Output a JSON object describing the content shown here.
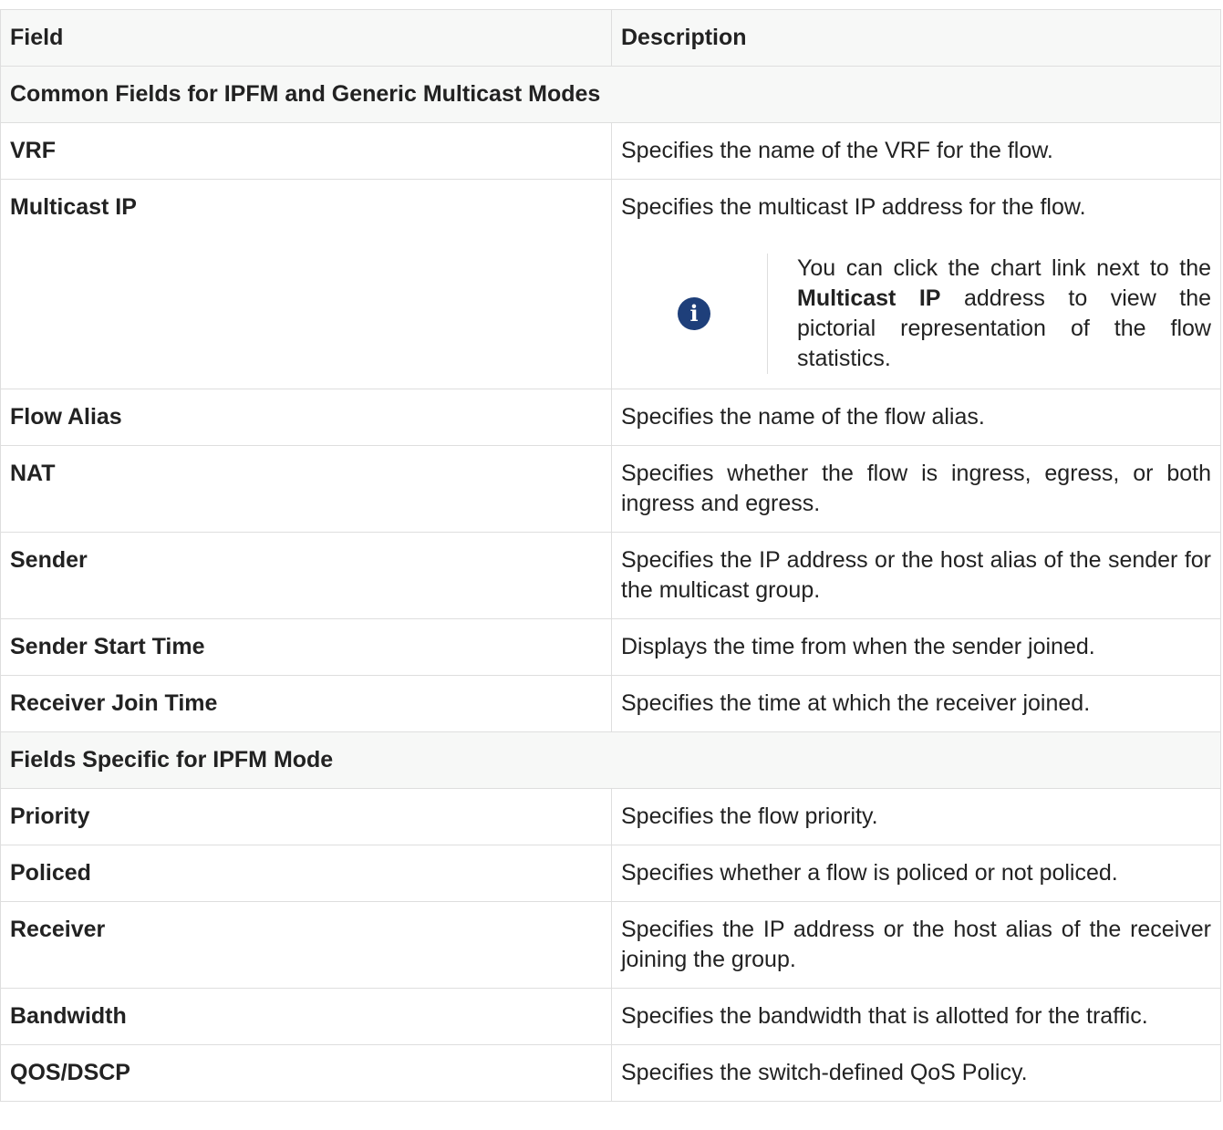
{
  "table": {
    "headers": {
      "field": "Field",
      "description": "Description"
    },
    "sections": [
      {
        "title": "Common Fields for IPFM and Generic Multicast Modes",
        "rows": [
          {
            "field": "VRF",
            "description": "Specifies the name of the VRF for the flow."
          },
          {
            "field": "Multicast IP",
            "description": "Specifies the multicast IP address for the flow.",
            "note": {
              "icon": "info-icon",
              "text_before": "You can click the chart link next to the ",
              "text_bold": "Multicast IP",
              "text_after": " address to view the pictorial representation of the flow statistics."
            }
          },
          {
            "field": "Flow Alias",
            "description": "Specifies the name of the flow alias."
          },
          {
            "field": "NAT",
            "description": "Specifies whether the flow is ingress, egress, or both ingress and egress."
          },
          {
            "field": "Sender",
            "description": "Specifies the IP address or the host alias of the sender for the multicast group."
          },
          {
            "field": "Sender Start Time",
            "description": "Displays the time from when the sender joined."
          },
          {
            "field": "Receiver Join Time",
            "description": "Specifies the time at which the receiver joined."
          }
        ]
      },
      {
        "title": "Fields Specific for IPFM Mode",
        "rows": [
          {
            "field": "Priority",
            "description": "Specifies the flow priority."
          },
          {
            "field": "Policed",
            "description": "Specifies whether a flow is policed or not policed."
          },
          {
            "field": "Receiver",
            "description": "Specifies the IP address or the host alias of the receiver joining the group."
          },
          {
            "field": "Bandwidth",
            "description": "Specifies the bandwidth that is allotted for the traffic."
          },
          {
            "field": "QOS/DSCP",
            "description": "Specifies the switch-defined QoS Policy."
          }
        ]
      }
    ]
  }
}
